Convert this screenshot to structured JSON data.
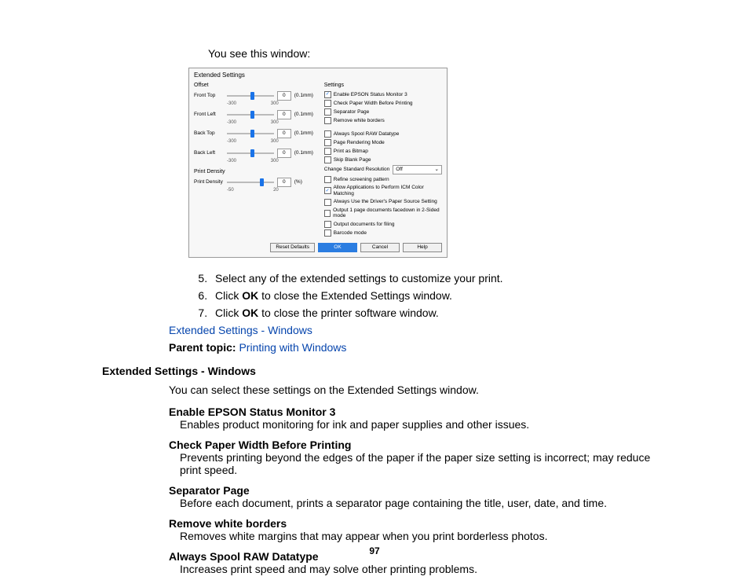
{
  "intro": "You see this window:",
  "dialog": {
    "title": "Extended Settings",
    "offset_label": "Offset",
    "sliders": [
      {
        "label": "Front Top",
        "value": "0",
        "unit": "(0.1mm)",
        "min": "-300",
        "max": "300",
        "pos": 50
      },
      {
        "label": "Front Left",
        "value": "0",
        "unit": "(0.1mm)",
        "min": "-300",
        "max": "300",
        "pos": 50
      },
      {
        "label": "Back Top",
        "value": "0",
        "unit": "(0.1mm)",
        "min": "-300",
        "max": "300",
        "pos": 50
      },
      {
        "label": "Back Left",
        "value": "0",
        "unit": "(0.1mm)",
        "min": "-300",
        "max": "300",
        "pos": 50
      }
    ],
    "density_group": "Print Density",
    "density": {
      "label": "Print Density",
      "value": "0",
      "unit": "(%)",
      "min": "-50",
      "max": "20",
      "pos": 70
    },
    "settings_label": "Settings",
    "checkboxes_top": [
      {
        "label": "Enable EPSON Status Monitor 3",
        "checked": true
      },
      {
        "label": "Check Paper Width Before Printing",
        "checked": false
      },
      {
        "label": "Separator Page",
        "checked": false
      },
      {
        "label": "Remove white borders",
        "checked": false
      }
    ],
    "checkboxes_mid": [
      {
        "label": "Always Spool RAW Datatype",
        "checked": false
      },
      {
        "label": "Page Rendering Mode",
        "checked": false
      },
      {
        "label": "Print as Bitmap",
        "checked": false
      },
      {
        "label": "Skip Blank Page",
        "checked": false
      }
    ],
    "resolution_label": "Change Standard Resolution",
    "resolution_value": "Off",
    "checkboxes_bot": [
      {
        "label": "Refine screening pattern",
        "checked": false
      },
      {
        "label": "Allow Applications to Perform ICM Color Matching",
        "checked": true
      },
      {
        "label": "Always Use the Driver's Paper Source Setting",
        "checked": false
      },
      {
        "label": "Output 1 page documents facedown in 2-Sided mode",
        "checked": false
      },
      {
        "label": "Output documents for filing",
        "checked": false
      },
      {
        "label": "Barcode mode",
        "checked": false
      }
    ],
    "buttons": {
      "reset": "Reset Defaults",
      "ok": "OK",
      "cancel": "Cancel",
      "help": "Help"
    }
  },
  "steps": [
    {
      "n": "5",
      "pre": "Select any of the extended settings to customize your print."
    },
    {
      "n": "6",
      "pre": "Click ",
      "bold": "OK",
      "post": " to close the Extended Settings window."
    },
    {
      "n": "7",
      "pre": "Click ",
      "bold": "OK",
      "post": " to close the printer software window."
    }
  ],
  "link1": "Extended Settings - Windows",
  "parent_label": "Parent topic:",
  "parent_link": "Printing with Windows",
  "heading": "Extended Settings - Windows",
  "section_intro": "You can select these settings on the Extended Settings window.",
  "defs": [
    {
      "term": "Enable EPSON Status Monitor 3",
      "desc": "Enables product monitoring for ink and paper supplies and other issues."
    },
    {
      "term": "Check Paper Width Before Printing",
      "desc": "Prevents printing beyond the edges of the paper if the paper size setting is incorrect; may reduce print speed."
    },
    {
      "term": "Separator Page",
      "desc": "Before each document, prints a separator page containing the title, user, date, and time."
    },
    {
      "term": "Remove white borders",
      "desc": "Removes white margins that may appear when you print borderless photos."
    },
    {
      "term": "Always Spool RAW Datatype",
      "desc": "Increases print speed and may solve other printing problems."
    }
  ],
  "pagenum": "97"
}
